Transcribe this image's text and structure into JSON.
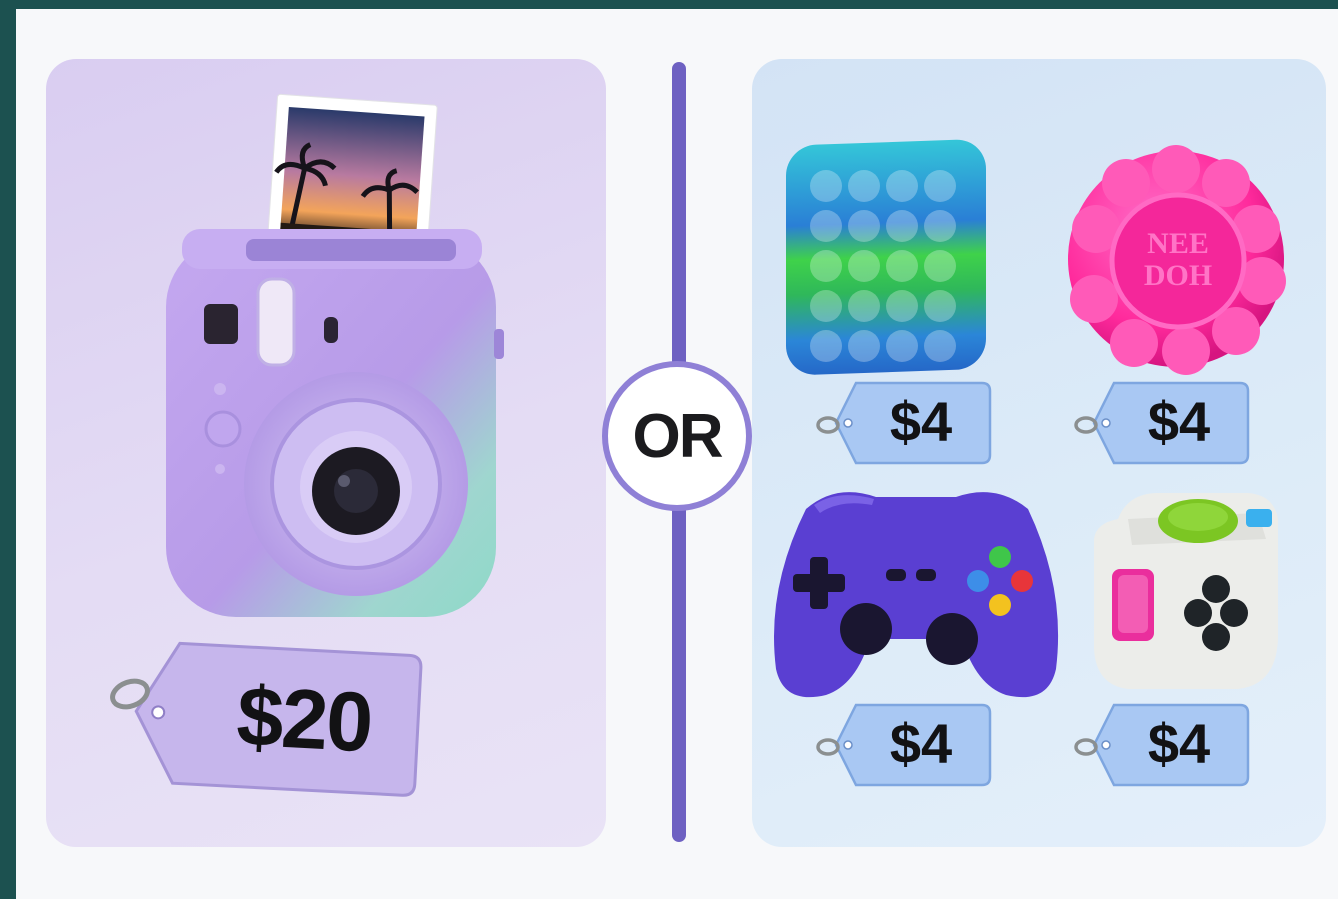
{
  "divider_label": "OR",
  "left_offer": {
    "item_icon": "instant-camera-icon",
    "price": "$20",
    "tag_color": "#c6b6ec"
  },
  "right_offers": [
    {
      "item_icon": "pop-it-fidget-icon",
      "price": "$4"
    },
    {
      "item_icon": "nee-doh-ball-icon",
      "price": "$4",
      "ball_text_line1": "NEE",
      "ball_text_line2": "DOH"
    },
    {
      "item_icon": "game-controller-icon",
      "price": "$4"
    },
    {
      "item_icon": "fidget-cube-icon",
      "price": "$4"
    }
  ],
  "colors": {
    "background": "#1c5150",
    "left_panel": "#e2d8f3",
    "right_panel": "#dbe9f7",
    "divider": "#6e61c2",
    "price_tag_blue": "#a9c8f3"
  }
}
